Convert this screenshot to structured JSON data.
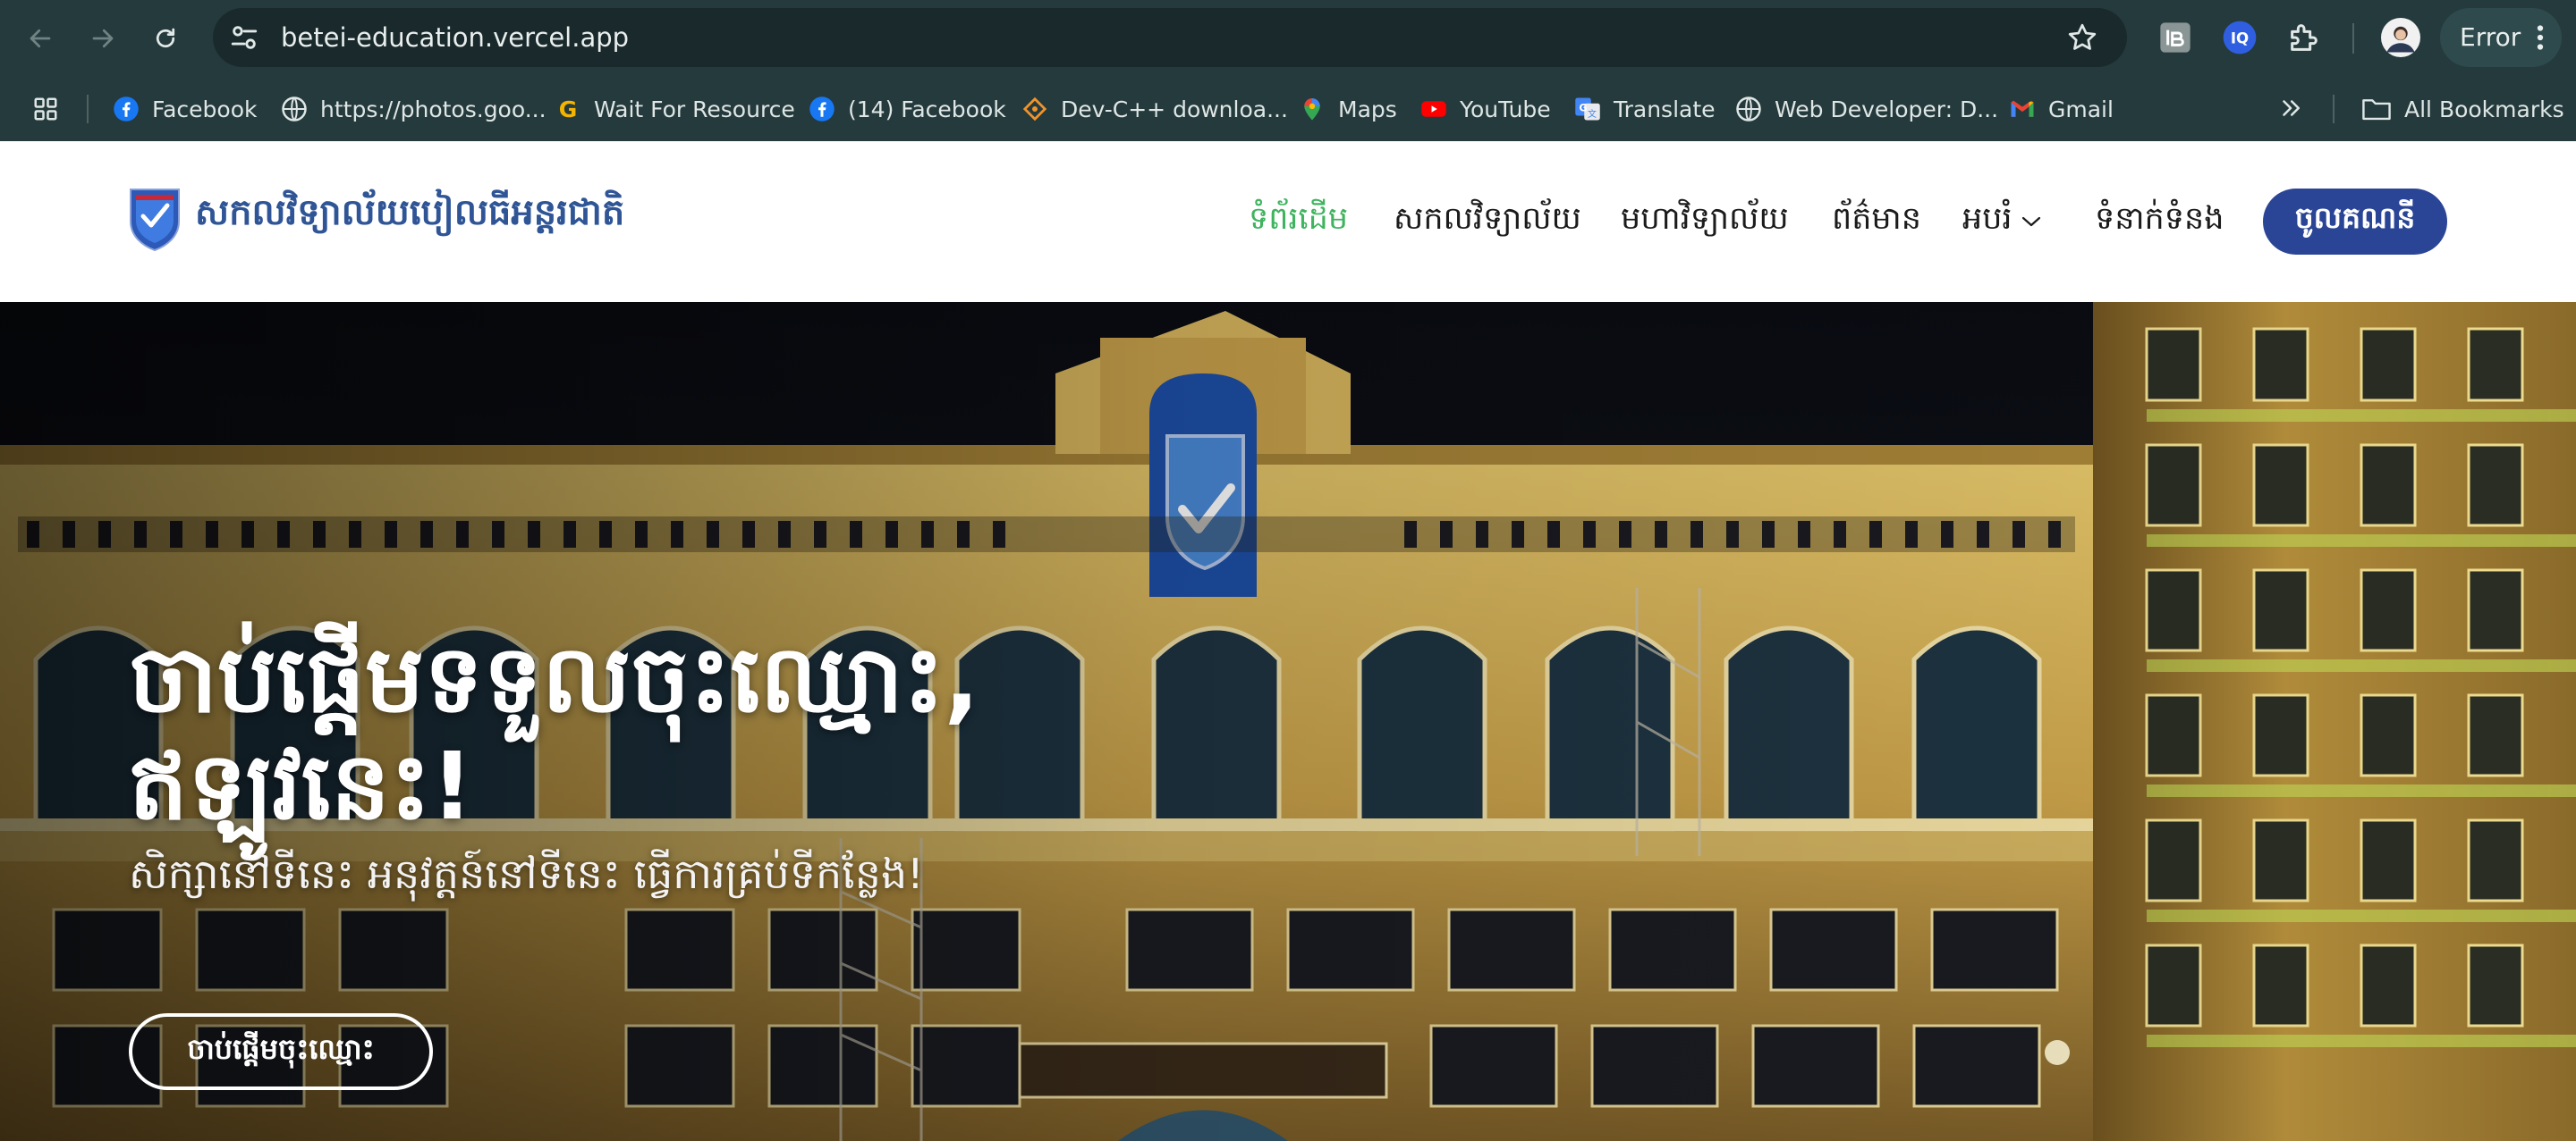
{
  "browser": {
    "url": "betei-education.vercel.app",
    "profile_status": "Error",
    "bookmarks": [
      {
        "label": "Facebook",
        "icon": "facebook-icon"
      },
      {
        "label": "https://photos.goo...",
        "icon": "globe-icon"
      },
      {
        "label": "Wait For Resource",
        "icon": "g-logo-icon"
      },
      {
        "label": "(14) Facebook",
        "icon": "facebook-icon"
      },
      {
        "label": "Dev-C++ downloa...",
        "icon": "devcpp-icon"
      },
      {
        "label": "Maps",
        "icon": "maps-icon"
      },
      {
        "label": "YouTube",
        "icon": "youtube-icon"
      },
      {
        "label": "Translate",
        "icon": "translate-icon"
      },
      {
        "label": "Web Developer: D...",
        "icon": "globe-icon"
      },
      {
        "label": "Gmail",
        "icon": "gmail-icon"
      }
    ],
    "all_bookmarks": "All Bookmarks"
  },
  "site": {
    "logo_text": "សកលវិទ្យាល័យបៀលធីអន្តរជាតិ",
    "nav": [
      {
        "label": "ទំព័រដើម",
        "active": true
      },
      {
        "label": "សកលវិទ្យាល័យ",
        "active": false
      },
      {
        "label": "មហាវិទ្យាល័យ",
        "active": false
      },
      {
        "label": "ព័ត៌មាន",
        "active": false
      },
      {
        "label": "អបរំ",
        "active": false,
        "dropdown": true
      },
      {
        "label": "ទំនាក់ទំនង",
        "active": false
      }
    ],
    "login_label": "ចូលគណនី"
  },
  "hero": {
    "title_line1": "ចាប់ផ្តើមទទួលចុះឈ្មោះ,",
    "title_line2": "ឥឡូវនេះ!",
    "subtitle": "សិក្សានៅទីនេះ អនុវត្តន៍នៅទីនេះ ធ្វើការគ្រប់ទីកន្លែង!",
    "cta_label": "ចាប់ផ្តើមចុះឈ្មោះ"
  },
  "colors": {
    "chrome_bg": "#253a3c",
    "brand_blue": "#2b4596",
    "nav_active": "#3fb45f"
  }
}
